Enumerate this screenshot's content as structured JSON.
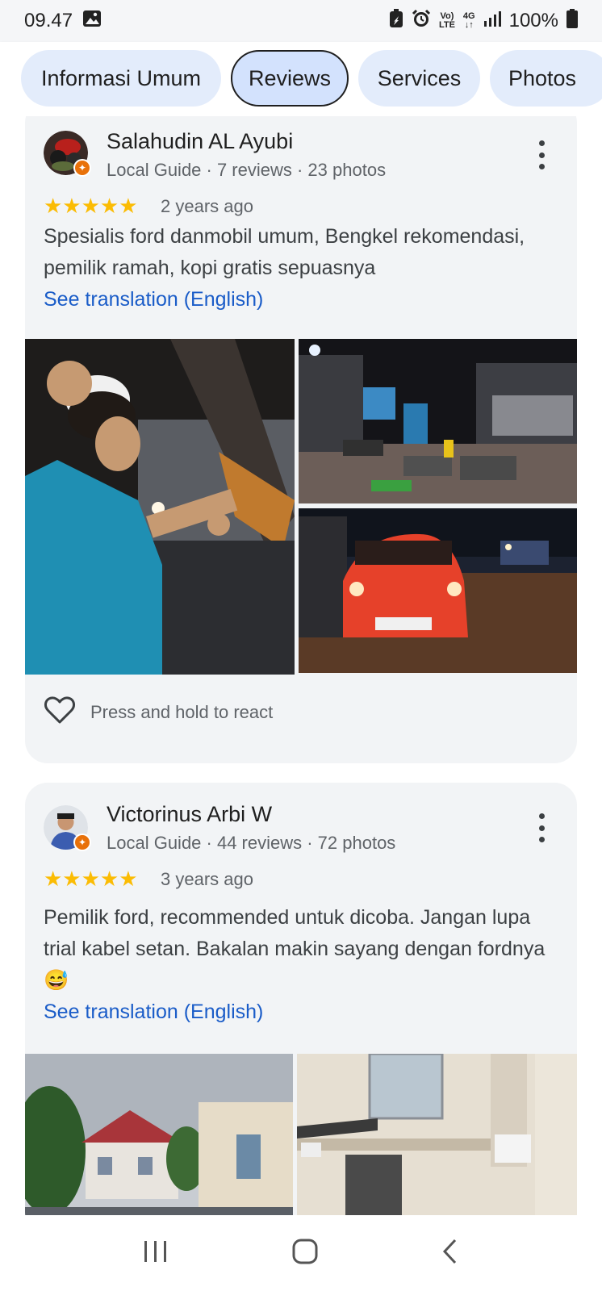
{
  "status_bar": {
    "time": "09.47",
    "network_top": "Vo)",
    "network_bottom": "LTE",
    "gen": "4G",
    "battery": "100%"
  },
  "tabs": [
    {
      "label": "Informasi Umum",
      "active": false
    },
    {
      "label": "Reviews",
      "active": true
    },
    {
      "label": "Services",
      "active": false
    },
    {
      "label": "Photos",
      "active": false
    }
  ],
  "reviews": [
    {
      "author": "Salahudin AL Ayubi",
      "meta": "Local Guide · 7 reviews · 23 photos",
      "rating": 5,
      "stars": "★★★★★",
      "when": "2 years ago",
      "text": "Spesialis ford danmobil umum, Bengkel rekomendasi, pemilik ramah, kopi gratis sepuasnya",
      "translate_label": "See translation (English)",
      "react_label": "Press and hold to react"
    },
    {
      "author": "Victorinus Arbi W",
      "meta": "Local Guide · 44 reviews · 72 photos",
      "rating": 5,
      "stars": "★★★★★",
      "when": "3 years ago",
      "text": "Pemilik ford, recommended untuk dicoba. Jangan lupa trial kabel setan. Bakalan makin sayang dengan fordnya😅",
      "translate_label": "See translation (English)"
    }
  ],
  "colors": {
    "star": "#fbbc04",
    "link": "#1a5cc8",
    "card_bg": "#f2f4f6",
    "tab_bg": "#e3ecfb",
    "badge": "#e8710a"
  }
}
